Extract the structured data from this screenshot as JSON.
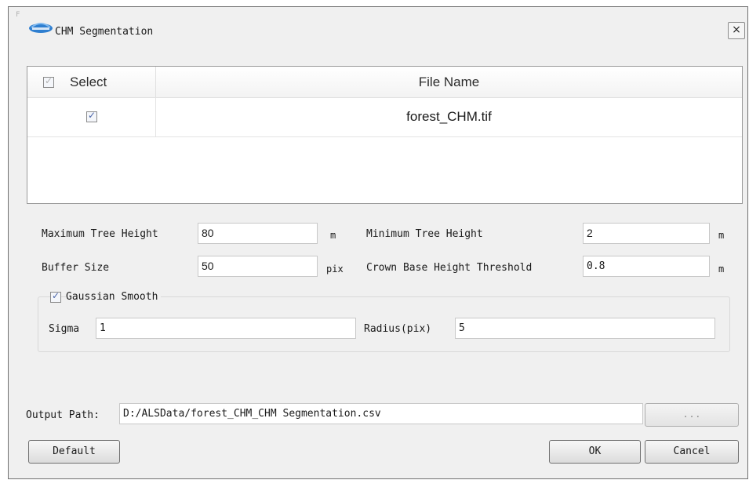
{
  "window": {
    "title": "CHM Segmentation",
    "corner_mark": "F",
    "close_label": "×"
  },
  "file_table": {
    "columns": [
      "Select",
      "File Name"
    ],
    "rows": [
      {
        "selected": true,
        "file_name": "forest_CHM.tif"
      }
    ]
  },
  "params": {
    "max_tree_height": {
      "label": "Maximum Tree Height",
      "value": "80",
      "unit": "m"
    },
    "min_tree_height": {
      "label": "Minimum Tree Height",
      "value": "2",
      "unit": "m"
    },
    "buffer_size": {
      "label": "Buffer Size",
      "value": "50",
      "unit": "pix"
    },
    "crown_base_threshold": {
      "label": "Crown Base Height Threshold",
      "value": "0.8",
      "unit": "m"
    }
  },
  "gaussian": {
    "label": "Gaussian Smooth",
    "enabled": true,
    "sigma": {
      "label": "Sigma",
      "value": "1"
    },
    "radius": {
      "label": "Radius(pix)",
      "value": "5"
    }
  },
  "output": {
    "label": "Output Path:",
    "value": "D:/ALSData/forest_CHM_CHM Segmentation.csv",
    "browse_label": "..."
  },
  "buttons": {
    "default": "Default",
    "ok": "OK",
    "cancel": "Cancel"
  },
  "colors": {
    "dialog_bg": "#f0f0f0",
    "check_accent": "#4a64a8"
  }
}
